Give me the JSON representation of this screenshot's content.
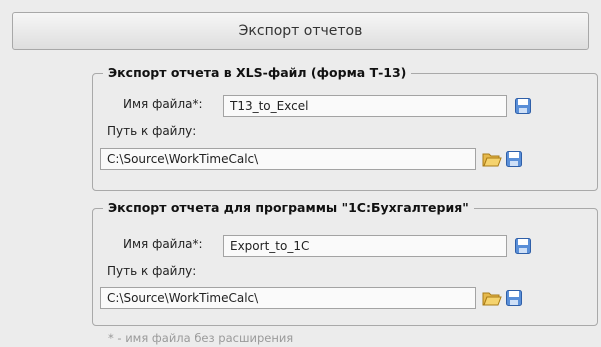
{
  "header": {
    "title": "Экспорт отчетов"
  },
  "groups": [
    {
      "legend": "Экспорт отчета  в XLS-файл (форма Т-13)",
      "file_name_label": "Имя файла*:",
      "file_name_value": "T13_to_Excel",
      "path_label": "Путь к файлу:",
      "path_value": "C:\\Source\\WorkTimeCalc\\"
    },
    {
      "legend": "Экспорт отчета для программы \"1С:Бухгалтерия\"",
      "file_name_label": "Имя файла*:",
      "file_name_value": "Export_to_1C",
      "path_label": "Путь к файлу:",
      "path_value": "C:\\Source\\WorkTimeCalc\\"
    }
  ],
  "footnote": "* - имя файла без расширения",
  "icons": {
    "save": "floppy-disk-icon",
    "folder": "folder-open-icon"
  }
}
